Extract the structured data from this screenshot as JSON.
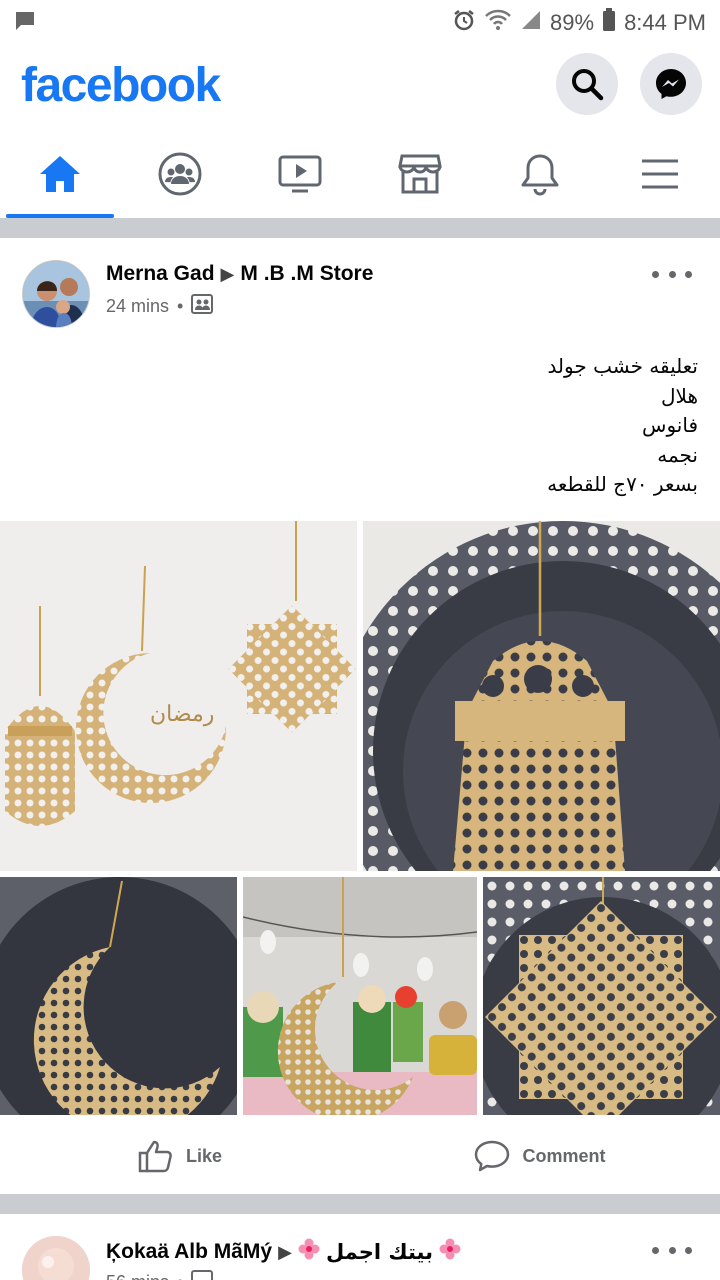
{
  "status_bar": {
    "battery": "89%",
    "time": "8:44 PM"
  },
  "header": {
    "brand": "facebook"
  },
  "nav": {
    "tabs": [
      {
        "icon": "home-icon",
        "active": true
      },
      {
        "icon": "groups-icon",
        "active": false
      },
      {
        "icon": "watch-icon",
        "active": false
      },
      {
        "icon": "marketplace-icon",
        "active": false
      },
      {
        "icon": "bell-icon",
        "active": false
      },
      {
        "icon": "menu-icon",
        "active": false
      }
    ]
  },
  "post": {
    "author": "Merna Gad",
    "group": "M .B .M Store",
    "time": "24 mins",
    "text_lines": [
      "تعليقه خشب  جولد",
      "هلال",
      "فانوس",
      "نجمه",
      "بسعر ٧٠ج للقطعه"
    ],
    "like_label": "Like",
    "comment_label": "Comment"
  },
  "post2": {
    "author": "Ķokaä Alb MãMý",
    "group": "بيتك اجمل",
    "time": "56 mins"
  },
  "colors": {
    "brand": "#1877f2",
    "secondary_text": "#65676b",
    "divider": "#c9ccd1"
  }
}
